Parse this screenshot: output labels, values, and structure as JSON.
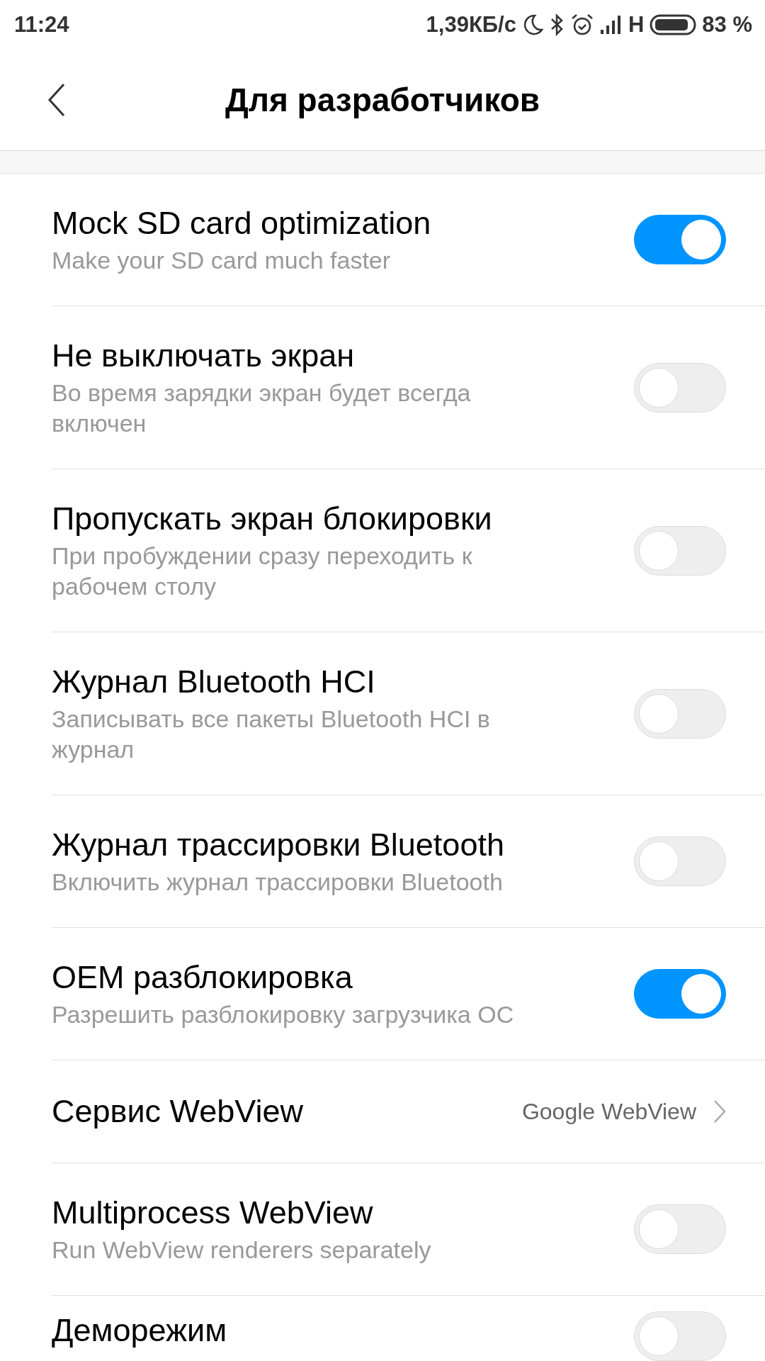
{
  "status_bar": {
    "time": "11:24",
    "speed": "1,39КБ/с",
    "network": "H",
    "battery": "83 %"
  },
  "header": {
    "title": "Для разработчиков"
  },
  "settings": [
    {
      "kind": "switch",
      "title": "Mock SD card optimization",
      "subtitle": "Make your SD card much faster",
      "on": true
    },
    {
      "kind": "switch",
      "title": "Не выключать экран",
      "subtitle": "Во время зарядки экран будет всегда включен",
      "on": false
    },
    {
      "kind": "switch",
      "title": "Пропускать экран блокировки",
      "subtitle": "При пробуждении сразу переходить к рабочем столу",
      "on": false
    },
    {
      "kind": "switch",
      "title": "Журнал Bluetooth HCI",
      "subtitle": "Записывать все пакеты Bluetooth HCI в журнал",
      "on": false
    },
    {
      "kind": "switch",
      "title": "Журнал трассировки Bluetooth",
      "subtitle": "Включить журнал трассировки Bluetooth",
      "on": false
    },
    {
      "kind": "switch",
      "title": "OEM разблокировка",
      "subtitle": "Разрешить разблокировку загрузчика ОС",
      "on": true
    },
    {
      "kind": "value",
      "title": "Сервис WebView",
      "value": "Google WebView"
    },
    {
      "kind": "switch",
      "title": "Multiprocess WebView",
      "subtitle": "Run WebView renderers separately",
      "on": false
    },
    {
      "kind": "switch",
      "title": "Деморежим",
      "on": false
    }
  ]
}
